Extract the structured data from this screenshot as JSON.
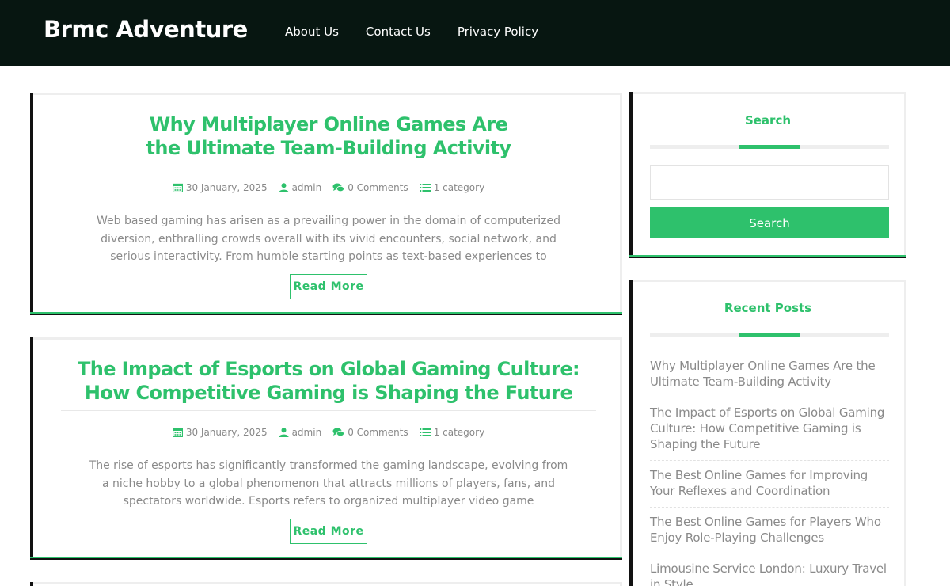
{
  "header": {
    "site_title": "Brmc Adventure",
    "nav": [
      {
        "label": "About Us"
      },
      {
        "label": "Contact Us"
      },
      {
        "label": "Privacy Policy"
      }
    ]
  },
  "posts": [
    {
      "title_line1": "Why Multiplayer Online Games Are",
      "title_line2": "the Ultimate Team-Building Activity",
      "date": "30 January, 2025",
      "author": "admin",
      "comments": "0 Comments",
      "category": "1 category",
      "excerpt": "Web based gaming has arisen as a prevailing power in the domain of computerized diversion, enthralling crowds overall with its vivid encounters, social network, and serious interactivity. From humble starting points as text-based experiences to",
      "read_more": "Read More"
    },
    {
      "title_line1": "The Impact of Esports on Global Gaming Culture:",
      "title_line2": "How Competitive Gaming is Shaping the Future",
      "date": "30 January, 2025",
      "author": "admin",
      "comments": "0 Comments",
      "category": "1 category",
      "excerpt": "The rise of esports has significantly transformed the gaming landscape, evolving from a niche hobby to a global phenomenon that attracts millions of players, fans, and spectators worldwide. Esports refers to organized multiplayer video game",
      "read_more": "Read More"
    }
  ],
  "sidebar": {
    "search": {
      "title": "Search",
      "placeholder": "",
      "button_label": "Search"
    },
    "recent_posts": {
      "title": "Recent Posts",
      "items": [
        {
          "label": "Why Multiplayer Online Games Are the Ultimate Team-Building Activity"
        },
        {
          "label": "The Impact of Esports on Global Gaming Culture: How Competitive Gaming is Shaping the Future"
        },
        {
          "label": "The Best Online Games for Improving Your Reflexes and Coordination"
        },
        {
          "label": "The Best Online Games for Players Who Enjoy Role-Playing Challenges"
        },
        {
          "label": "Limousine Service London: Luxury Travel in Style"
        }
      ]
    }
  },
  "colors": {
    "accent": "#2ec16c",
    "header_bg": "#071611",
    "text_muted": "#8a8a8a"
  },
  "icons": {
    "date": "calendar-icon",
    "author": "user-icon",
    "comments": "comments-icon",
    "category": "list-icon"
  }
}
